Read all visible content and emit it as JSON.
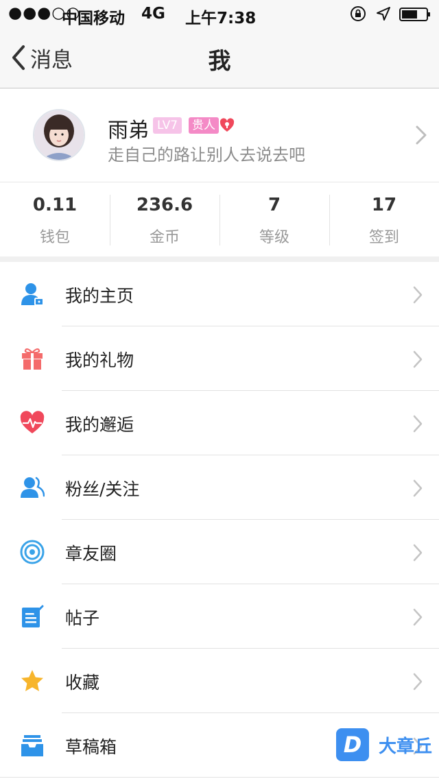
{
  "status_bar": {
    "signal": "●●●○○",
    "carrier": "中国移动",
    "network": "4G",
    "time": "上午7:38"
  },
  "navbar": {
    "back_label": "消息",
    "title": "我"
  },
  "profile": {
    "name": "雨弟",
    "level_badge": "LV7",
    "vip_badge": "贵人",
    "signature": "走自己的路让别人去说去吧"
  },
  "stats": [
    {
      "value": "0.11",
      "label": "钱包"
    },
    {
      "value": "236.6",
      "label": "金币"
    },
    {
      "value": "7",
      "label": "等级"
    },
    {
      "value": "17",
      "label": "签到"
    }
  ],
  "menu": [
    {
      "label": "我的主页",
      "icon": "person-icon",
      "color": "#2e93e8"
    },
    {
      "label": "我的礼物",
      "icon": "gift-icon",
      "color": "#f46b6b"
    },
    {
      "label": "我的邂逅",
      "icon": "heartbeat-icon",
      "color": "#f0485b"
    },
    {
      "label": "粉丝/关注",
      "icon": "people-icon",
      "color": "#2e93e8"
    },
    {
      "label": "章友圈",
      "icon": "circle-icon",
      "color": "#3aa3e8"
    },
    {
      "label": "帖子",
      "icon": "post-icon",
      "color": "#2e93e8"
    },
    {
      "label": "收藏",
      "icon": "star-icon",
      "color": "#f7b52c"
    },
    {
      "label": "草稿箱",
      "icon": "drafts-icon",
      "color": "#2e93e8"
    }
  ],
  "watermark": {
    "logo_letter": "D",
    "text": "大章丘"
  }
}
